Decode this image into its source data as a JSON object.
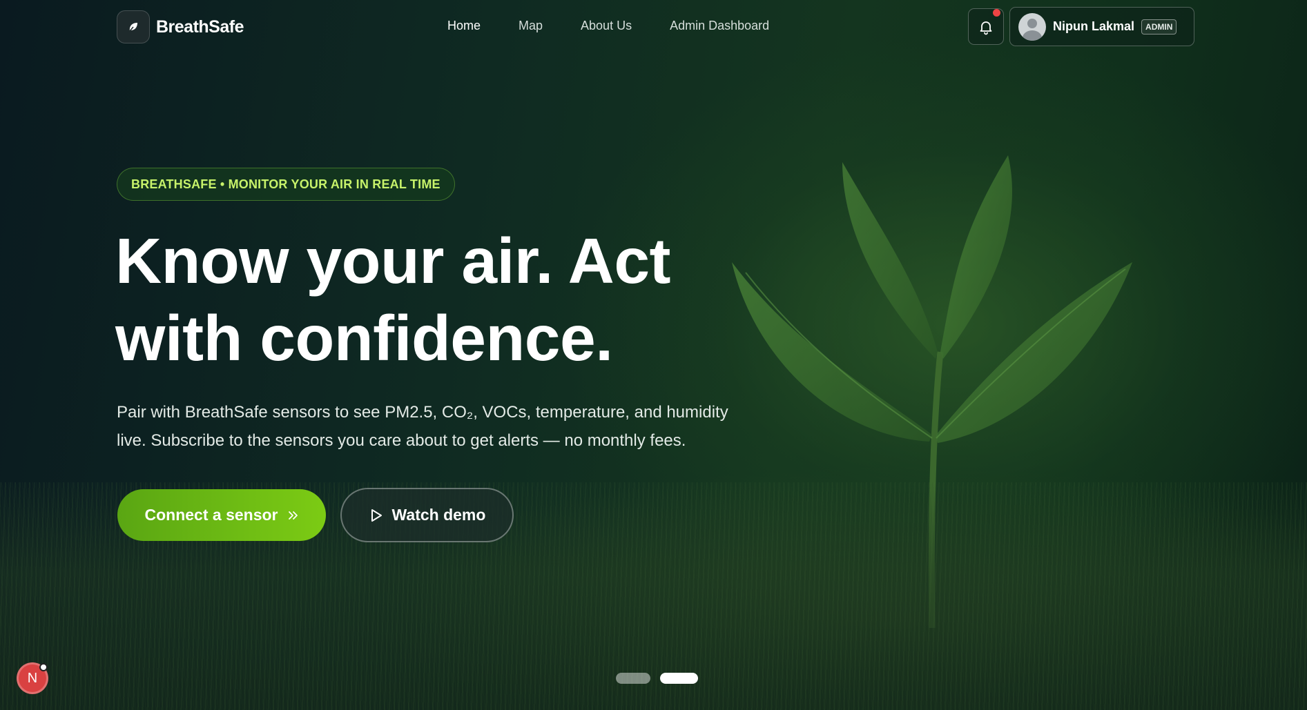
{
  "brand": {
    "name": "BreathSafe"
  },
  "nav": {
    "links": [
      {
        "label": "Home",
        "active": true
      },
      {
        "label": "Map",
        "active": false
      },
      {
        "label": "About Us",
        "active": false
      },
      {
        "label": "Admin Dashboard",
        "active": false
      }
    ]
  },
  "user": {
    "name": "Nipun Lakmal",
    "role": "ADMIN",
    "has_notifications": true
  },
  "hero": {
    "eyebrow": "BREATHSAFE • MONITOR YOUR AIR IN REAL TIME",
    "headline_line1": "Know your air. Act",
    "headline_line2": "with confidence.",
    "subtext_line1": "Pair with BreathSafe sensors to see PM2.5, CO₂, VOCs, temperature, and humidity",
    "subtext_line2": "live. Subscribe to the sensors you care about to get alerts — no monthly fees.",
    "primary_cta": "Connect a sensor",
    "secondary_cta": "Watch demo"
  },
  "carousel": {
    "slides": 2,
    "active_index": 1
  },
  "dev_badge": {
    "letter": "N"
  },
  "colors": {
    "accent_green": "#6fbd14",
    "eyebrow_text": "#c7f26a",
    "notification_dot": "#ef4444",
    "dev_badge": "#d94141"
  },
  "icons": {
    "brand": "leaf-logo-icon",
    "bell": "bell-icon",
    "chevron": "chevron-down-icon",
    "primary_cta": "double-chevron-right-icon",
    "secondary_cta": "play-icon"
  }
}
